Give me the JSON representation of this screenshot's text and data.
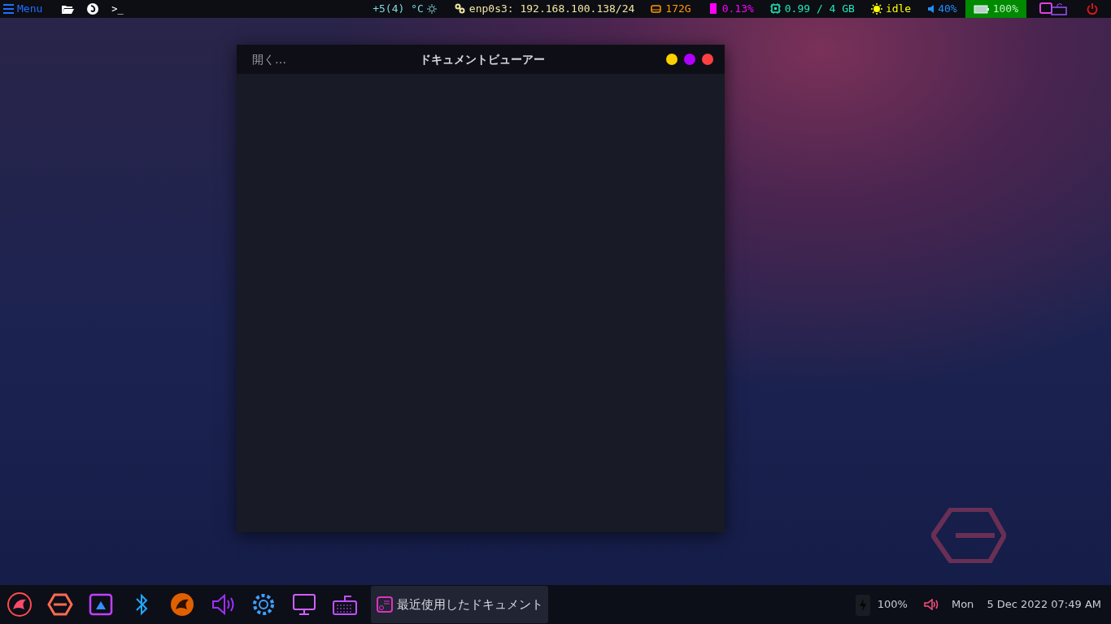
{
  "top_bar": {
    "menu": {
      "label": "Menu"
    },
    "terminal": ">_",
    "modules": [
      {
        "kind": "temp",
        "text": "+5(4) °C",
        "color": "#7fd8d8"
      },
      {
        "kind": "network",
        "text": "enp0s3: 192.168.100.138/24",
        "color": "#f0e6a0"
      },
      {
        "kind": "disk",
        "text": "172G",
        "color": "#ff9a00"
      },
      {
        "kind": "cpu",
        "text": "0.13%",
        "color": "#ff00ff"
      },
      {
        "kind": "memory",
        "text": "0.99 / 4 GB",
        "color": "#1de9b6"
      },
      {
        "kind": "idle",
        "text": "idle",
        "color": "#ffff00"
      },
      {
        "kind": "volume",
        "text": "40%",
        "color": "#1e90ff"
      },
      {
        "kind": "battery",
        "text": "100%",
        "color": "#b8f0c0"
      }
    ]
  },
  "window": {
    "title": "ドキュメントビューアー",
    "open_button": "開く…",
    "controls": [
      {
        "color": "#ffd000"
      },
      {
        "color": "#b000ff"
      },
      {
        "color": "#ff4040"
      }
    ]
  },
  "taskbar": {
    "task": {
      "label": "最近使用したドキュメント",
      "selected": true
    },
    "tray": {
      "battery": "100%",
      "day": "Mon",
      "datetime": "5 Dec 2022 07:49 AM"
    }
  }
}
